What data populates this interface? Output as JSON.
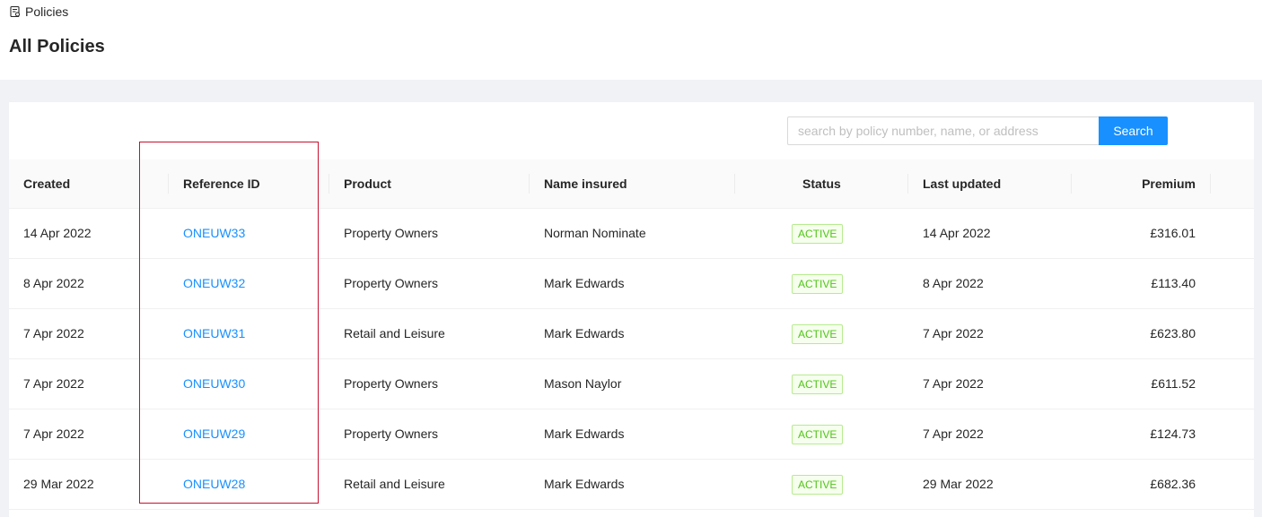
{
  "breadcrumb": {
    "label": "Policies",
    "icon": "document-icon"
  },
  "page_title": "All Policies",
  "search": {
    "placeholder": "search by policy number, name, or address",
    "value": "",
    "button_label": "Search"
  },
  "table": {
    "columns": [
      "Created",
      "Reference ID",
      "Product",
      "Name insured",
      "Status",
      "Last updated",
      "Premium"
    ],
    "rows": [
      {
        "created": "14 Apr 2022",
        "ref": "ONEUW33",
        "product": "Property Owners",
        "name": "Norman Nominate",
        "status": "ACTIVE",
        "updated": "14 Apr 2022",
        "premium": "£316.01"
      },
      {
        "created": "8 Apr 2022",
        "ref": "ONEUW32",
        "product": "Property Owners",
        "name": "Mark Edwards",
        "status": "ACTIVE",
        "updated": "8 Apr 2022",
        "premium": "£113.40"
      },
      {
        "created": "7 Apr 2022",
        "ref": "ONEUW31",
        "product": "Retail and Leisure",
        "name": "Mark Edwards",
        "status": "ACTIVE",
        "updated": "7 Apr 2022",
        "premium": "£623.80"
      },
      {
        "created": "7 Apr 2022",
        "ref": "ONEUW30",
        "product": "Property Owners",
        "name": "Mason Naylor",
        "status": "ACTIVE",
        "updated": "7 Apr 2022",
        "premium": "£611.52"
      },
      {
        "created": "7 Apr 2022",
        "ref": "ONEUW29",
        "product": "Property Owners",
        "name": "Mark Edwards",
        "status": "ACTIVE",
        "updated": "7 Apr 2022",
        "premium": "£124.73"
      },
      {
        "created": "29 Mar 2022",
        "ref": "ONEUW28",
        "product": "Retail and Leisure",
        "name": "Mark Edwards",
        "status": "ACTIVE",
        "updated": "29 Mar 2022",
        "premium": "£682.36"
      }
    ]
  },
  "colors": {
    "accent": "#1890ff",
    "status_active": "#52c41a",
    "highlight_border": "#c8102e"
  }
}
